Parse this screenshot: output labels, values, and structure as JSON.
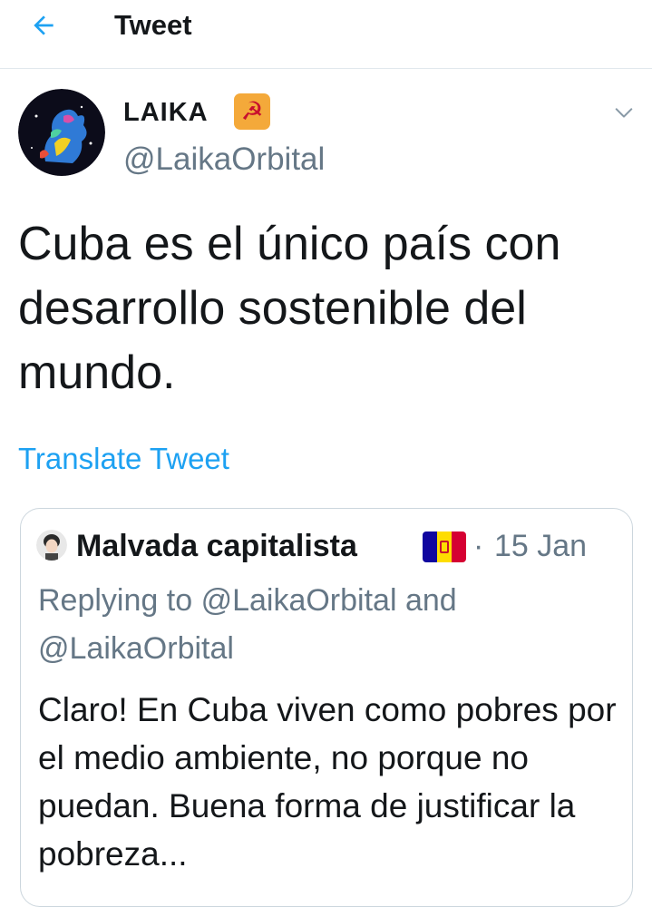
{
  "header": {
    "back_icon": "arrow-left-icon",
    "title": "Tweet"
  },
  "tweet": {
    "author": {
      "name": "LAIKA",
      "badge_emoji": "☭",
      "handle": "@LaikaOrbital"
    },
    "more_icon": "chevron-down-icon",
    "text": "Cuba es el único país con desarrollo sostenible del mundo.",
    "translate_label": "Translate Tweet"
  },
  "quoted_tweet": {
    "author": {
      "name": "Malvada capitalista",
      "flag": "Andorra"
    },
    "separator": "·",
    "date": "15 Jan",
    "replying_prefix": "Replying to",
    "reply_to_1": "@LaikaOrbital",
    "reply_conj": "and",
    "reply_to_2": "@LaikaOrbital",
    "text": "Claro! En Cuba viven como pobres por el medio ambiente, no porque no puedan. Buena forma de justificar la pobreza..."
  },
  "colors": {
    "accent": "#1da1f2",
    "secondary_text": "#657786",
    "primary_text": "#14171a",
    "border": "#ccd6dd"
  }
}
